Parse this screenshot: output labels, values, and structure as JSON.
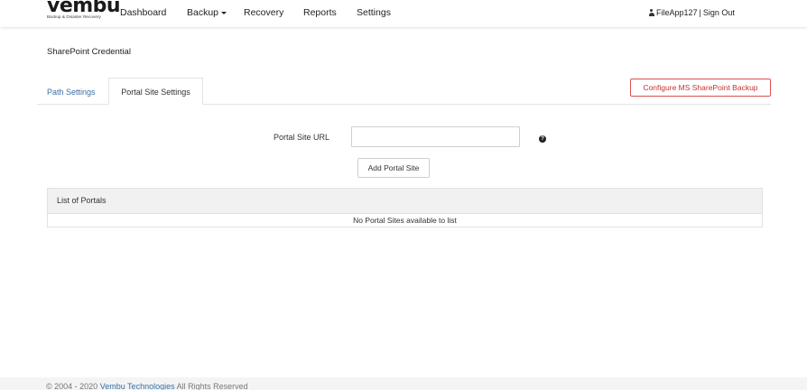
{
  "header": {
    "logo_text": "vembu",
    "logo_tagline": "Backup & Disaster Recovery",
    "nav": [
      {
        "label": "Dashboard"
      },
      {
        "label": "Backup"
      },
      {
        "label": "Recovery"
      },
      {
        "label": "Reports"
      },
      {
        "label": "Settings"
      }
    ],
    "user": "FileApp127",
    "separator": "|",
    "sign_out": "Sign Out"
  },
  "page": {
    "title": "SharePoint Credential",
    "tabs": [
      {
        "label": "Path Settings",
        "active": false
      },
      {
        "label": "Portal Site Settings",
        "active": true
      }
    ],
    "configure_button": "Configure MS SharePoint Backup",
    "form": {
      "url_label": "Portal Site URL",
      "url_value": "",
      "help_glyph": "?",
      "add_button": "Add Portal Site"
    },
    "portals": {
      "heading": "List of Portals",
      "empty_message": "No Portal Sites available to list"
    }
  },
  "footer": {
    "copyright": "© 2004 - 2020",
    "company": "Vembu Technologies",
    "rights": "All Rights Reserved"
  },
  "colors": {
    "link": "#3a6ea5",
    "danger": "#d9534f",
    "panel_header": "#f1f1f1"
  }
}
